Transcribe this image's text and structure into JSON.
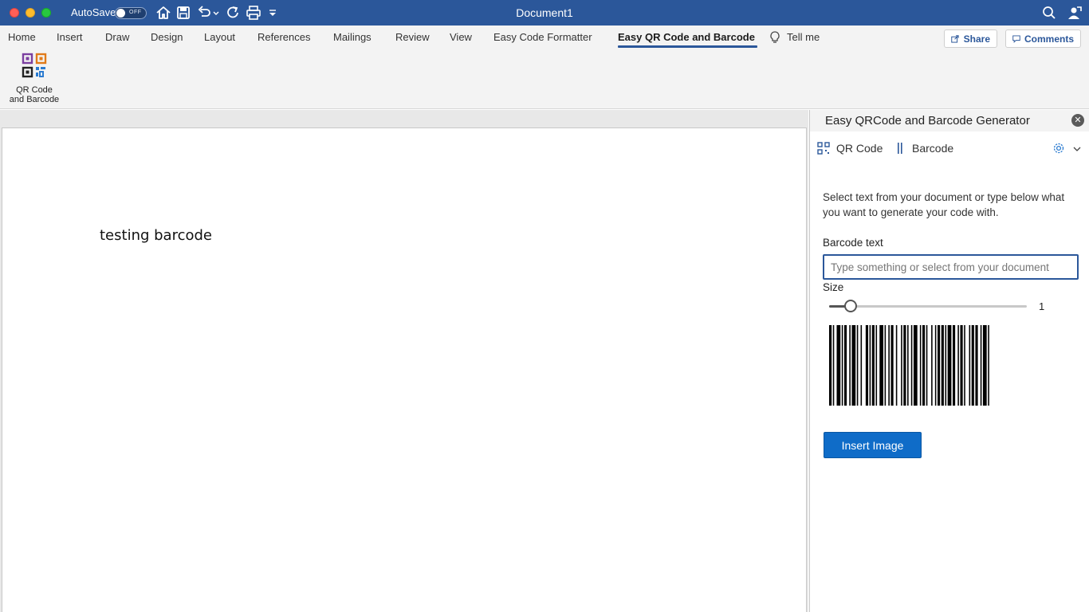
{
  "titlebar": {
    "autosave_label": "AutoSave",
    "autosave_state": "OFF",
    "document_title": "Document1",
    "background_color": "#2b579a",
    "quick_access_icons": [
      "home-icon",
      "save-icon",
      "undo-icon",
      "redo-icon",
      "print-icon",
      "customize-icon"
    ],
    "right_icons": [
      "search-icon",
      "account-icon"
    ]
  },
  "ribbon": {
    "tabs": [
      {
        "label": "Home"
      },
      {
        "label": "Insert"
      },
      {
        "label": "Draw"
      },
      {
        "label": "Design"
      },
      {
        "label": "Layout"
      },
      {
        "label": "References"
      },
      {
        "label": "Mailings"
      },
      {
        "label": "Review"
      },
      {
        "label": "View"
      },
      {
        "label": "Easy Code Formatter"
      },
      {
        "label": "Easy QR Code and Barcode",
        "active": true
      }
    ],
    "tell_me": "Tell me",
    "share_label": "Share",
    "comments_label": "Comments",
    "button_label_line1": "QR Code",
    "button_label_line2": "and Barcode"
  },
  "document": {
    "text": "testing barcode"
  },
  "pane": {
    "title": "Easy QRCode and Barcode Generator",
    "tab_qr": "QR Code",
    "tab_barcode": "Barcode",
    "instructions": "Select text from your document or type below what you want to generate your code with.",
    "field_label": "Barcode text",
    "field_value": "",
    "field_placeholder": "Type something or select from your document",
    "size_label": "Size",
    "size_value": "1",
    "size_fraction": 0.11,
    "insert_button": "Insert Image",
    "accent_color": "#0f6cc8"
  }
}
